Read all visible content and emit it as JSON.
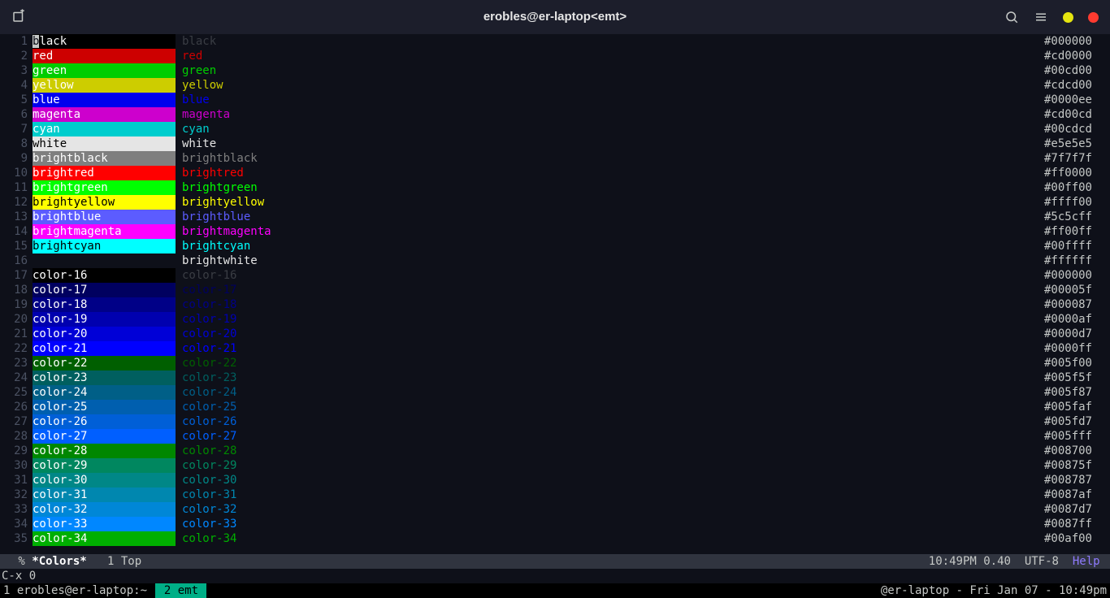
{
  "titlebar": {
    "title": "erobles@er-laptop<emt>"
  },
  "rows": [
    {
      "n": 1,
      "name": "black",
      "hex": "#000000",
      "nameDark": true
    },
    {
      "n": 2,
      "name": "red",
      "hex": "#cd0000"
    },
    {
      "n": 3,
      "name": "green",
      "hex": "#00cd00"
    },
    {
      "n": 4,
      "name": "yellow",
      "hex": "#cdcd00"
    },
    {
      "n": 5,
      "name": "blue",
      "hex": "#0000ee"
    },
    {
      "n": 6,
      "name": "magenta",
      "hex": "#cd00cd"
    },
    {
      "n": 7,
      "name": "cyan",
      "hex": "#00cdcd"
    },
    {
      "n": 8,
      "name": "white",
      "hex": "#e5e5e5",
      "swatchDarkText": true,
      "whiteFg": true
    },
    {
      "n": 9,
      "name": "brightblack",
      "hex": "#7f7f7f"
    },
    {
      "n": 10,
      "name": "brightred",
      "hex": "#ff0000"
    },
    {
      "n": 11,
      "name": "brightgreen",
      "hex": "#00ff00"
    },
    {
      "n": 12,
      "name": "brightyellow",
      "hex": "#ffff00",
      "swatchDarkText": true
    },
    {
      "n": 13,
      "name": "brightblue",
      "hex": "#5c5cff"
    },
    {
      "n": 14,
      "name": "brightmagenta",
      "hex": "#ff00ff"
    },
    {
      "n": 15,
      "name": "brightcyan",
      "hex": "#00ffff",
      "swatchDarkText": true
    },
    {
      "n": 16,
      "name": "brightwhite",
      "hex": "#ffffff",
      "swatchDarkText": true,
      "whiteFg": true,
      "hideSwatchText": true
    },
    {
      "n": 17,
      "name": "color-16",
      "hex": "#000000",
      "nameDark": true
    },
    {
      "n": 18,
      "name": "color-17",
      "hex": "#00005f"
    },
    {
      "n": 19,
      "name": "color-18",
      "hex": "#000087"
    },
    {
      "n": 20,
      "name": "color-19",
      "hex": "#0000af"
    },
    {
      "n": 21,
      "name": "color-20",
      "hex": "#0000d7"
    },
    {
      "n": 22,
      "name": "color-21",
      "hex": "#0000ff"
    },
    {
      "n": 23,
      "name": "color-22",
      "hex": "#005f00"
    },
    {
      "n": 24,
      "name": "color-23",
      "hex": "#005f5f"
    },
    {
      "n": 25,
      "name": "color-24",
      "hex": "#005f87"
    },
    {
      "n": 26,
      "name": "color-25",
      "hex": "#005faf"
    },
    {
      "n": 27,
      "name": "color-26",
      "hex": "#005fd7"
    },
    {
      "n": 28,
      "name": "color-27",
      "hex": "#005fff"
    },
    {
      "n": 29,
      "name": "color-28",
      "hex": "#008700"
    },
    {
      "n": 30,
      "name": "color-29",
      "hex": "#00875f"
    },
    {
      "n": 31,
      "name": "color-30",
      "hex": "#008787"
    },
    {
      "n": 32,
      "name": "color-31",
      "hex": "#0087af"
    },
    {
      "n": 33,
      "name": "color-32",
      "hex": "#0087d7"
    },
    {
      "n": 34,
      "name": "color-33",
      "hex": "#0087ff"
    },
    {
      "n": 35,
      "name": "color-34",
      "hex": "#00af00"
    }
  ],
  "modeline": {
    "left_prefix": " % ",
    "buffer": "*Colors*",
    "pos": "   1 Top",
    "time": "10:49PM",
    "load": "0.40",
    "enc": "UTF-8",
    "help": "Help"
  },
  "minibuffer": "C-x 0",
  "tmux": {
    "win1": "1 erobles@er-laptop:~ ",
    "win2": " 2 emt ",
    "right": "@er-laptop - Fri Jan 07 - 10:49pm"
  }
}
